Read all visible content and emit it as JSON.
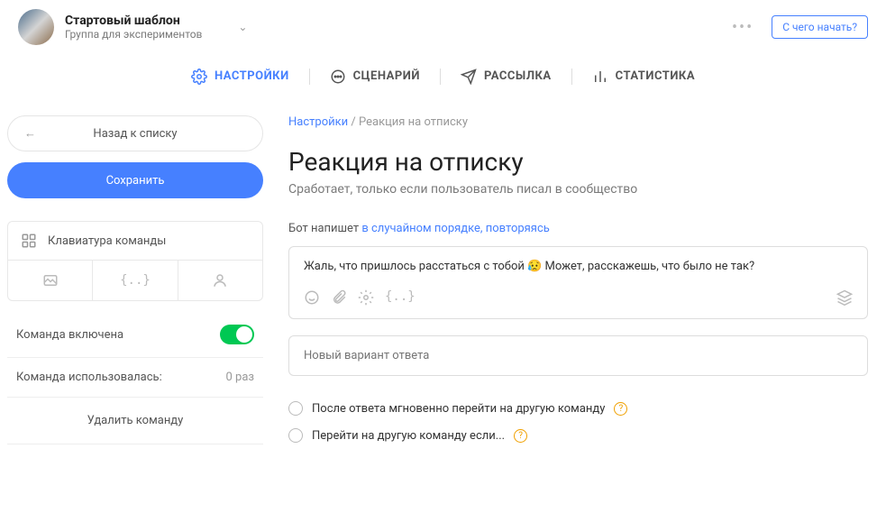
{
  "header": {
    "group_title": "Стартовый шаблон",
    "group_subtitle": "Группа для экспериментов",
    "start_button": "С чего начать?"
  },
  "nav": {
    "settings": "НАСТРОЙКИ",
    "scenario": "СЦЕНАРИЙ",
    "mailing": "РАССЫЛКА",
    "stats": "СТАТИСТИКА"
  },
  "sidebar": {
    "back": "Назад к списку",
    "save": "Сохранить",
    "keyboard": "Клавиатура команды",
    "enabled": "Команда включена",
    "usage_label": "Команда использовалась:",
    "usage_value": "0 раз",
    "delete": "Удалить команду"
  },
  "content": {
    "breadcrumb_root": "Настройки",
    "breadcrumb_sep": " / ",
    "breadcrumb_current": "Реакция на отписку",
    "title": "Реакция на отписку",
    "subtitle": "Сработает, только если пользователь писал в сообщество",
    "bot_prefix": "Бот напишет ",
    "bot_link": "в случайном порядке, повторяясь",
    "message": "Жаль, что пришлось расстаться с тобой 😥 Может, расскажешь, что было не так?",
    "new_variant_placeholder": "Новый вариант ответа",
    "radio1": "После ответа мгновенно перейти на другую команду",
    "radio2": "Перейти на другую команду если..."
  }
}
